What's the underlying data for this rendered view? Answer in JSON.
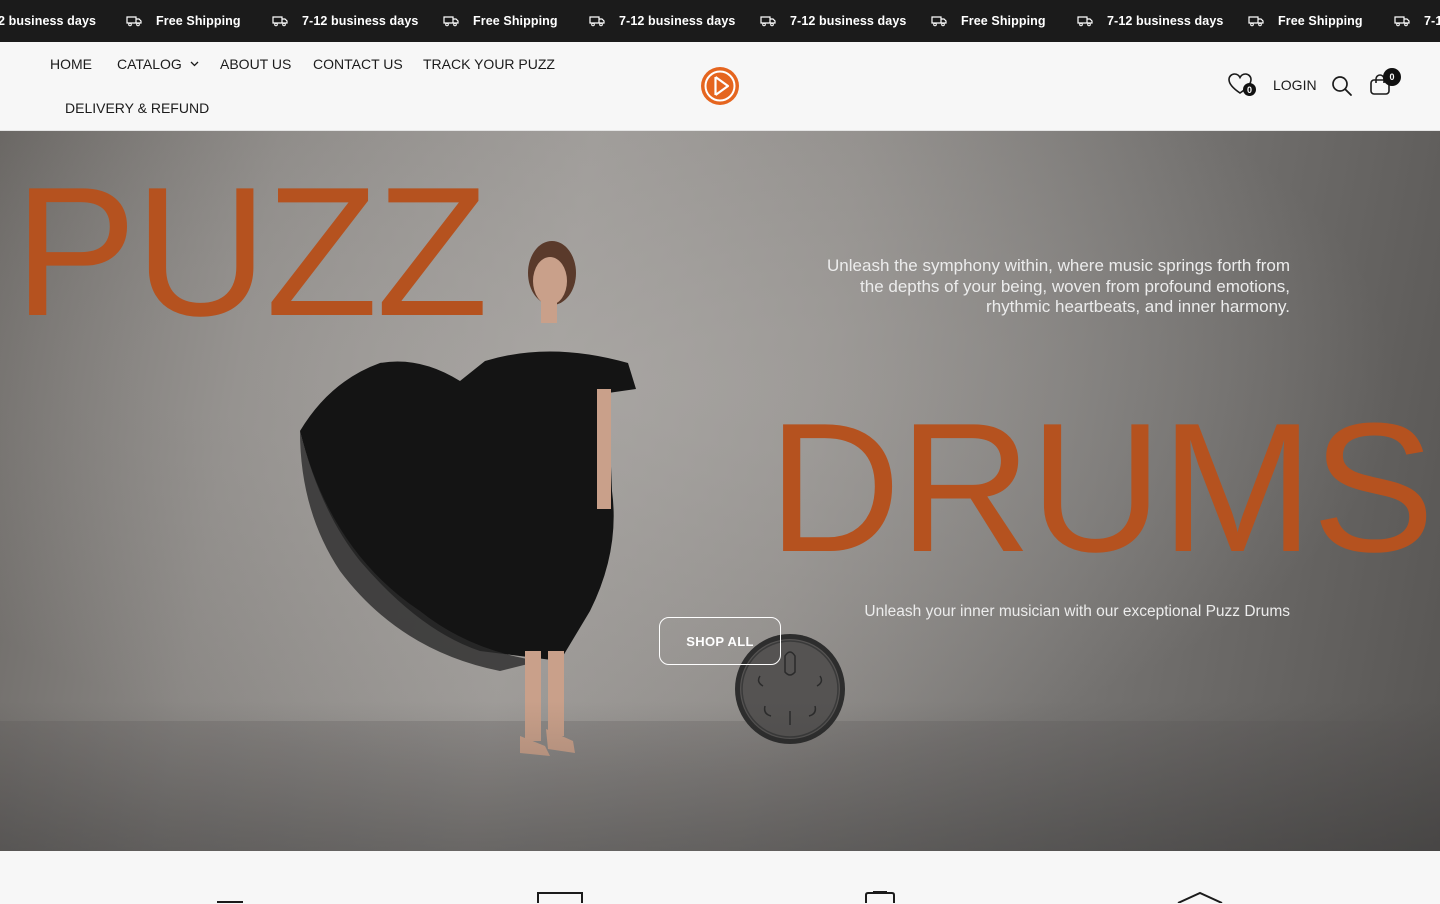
{
  "announcement": {
    "items": [
      {
        "text": "2 business days",
        "icon": "truck-icon"
      },
      {
        "text": "Free Shipping",
        "icon": "truck-icon"
      },
      {
        "text": "7-12 business days",
        "icon": "truck-icon"
      },
      {
        "text": "Free Shipping",
        "icon": "truck-icon"
      },
      {
        "text": "7-12 business days",
        "icon": "truck-icon"
      },
      {
        "text": "7-12 business days",
        "icon": "truck-icon"
      },
      {
        "text": "Free Shipping",
        "icon": "truck-icon"
      },
      {
        "text": "7-12 business days",
        "icon": "truck-icon"
      },
      {
        "text": "Free Shipping",
        "icon": "truck-icon"
      },
      {
        "text": "7-1",
        "icon": "truck-icon"
      }
    ]
  },
  "nav": {
    "home": "HOME",
    "catalog": "CATALOG",
    "about": "ABOUT US",
    "contact": "CONTACT US",
    "track": "TRACK YOUR PUZZ",
    "delivery": "DELIVERY & REFUND"
  },
  "header": {
    "wishlist_count": "0",
    "login": "LOGIN",
    "cart_count": "0"
  },
  "hero": {
    "title_top": "PUZZ",
    "title_bottom": "DRUMS",
    "tagline": "Unleash the symphony within, where music springs forth from the depths of your being, woven from profound emotions, rhythmic heartbeats, and inner harmony.",
    "subtagline": "Unleash your inner musician with our exceptional Puzz Drums",
    "cta": "SHOP ALL"
  },
  "colors": {
    "accent": "#b5521f",
    "logo": "#e5651f",
    "announcement_bg": "#1b1b1b"
  }
}
